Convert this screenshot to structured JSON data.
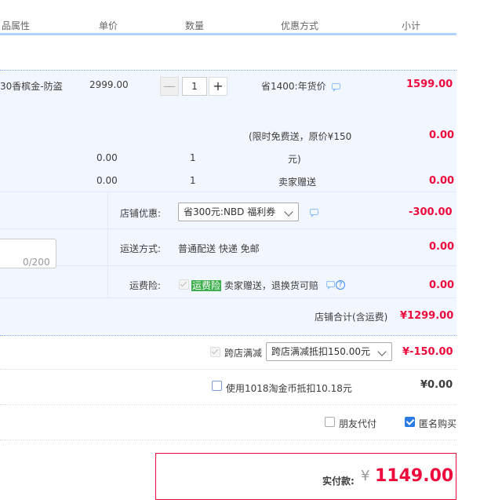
{
  "header": {
    "attr": "品属性",
    "price": "单价",
    "qty": "数量",
    "discount": "优惠方式",
    "subtotal": "小计"
  },
  "item": {
    "attr_text": "30香槟金-防盗",
    "price": "2999.00",
    "qty": "1",
    "discount": "省1400:年货价",
    "subtotal": "1599.00",
    "stepper_minus": "—",
    "stepper_plus": "+"
  },
  "gift": {
    "promo_line1": "(限时免费送，原价¥150",
    "promo_line2": "元)",
    "promo_amount": "0.00",
    "gift1_price": "0.00",
    "gift1_qty": "1",
    "gift2_price": "0.00",
    "gift2_qty": "1",
    "gift2_desc": "卖家赠送",
    "gift2_amount": "0.00"
  },
  "shop": {
    "coupon_label": "店铺优惠:",
    "coupon_select": "省300元:NBD 福利券",
    "coupon_amount": "-300.00",
    "shipping_label": "运送方式:",
    "shipping_value": "普通配送 快递 免邮",
    "shipping_amount": "0.00",
    "insurance_label": "运费险:",
    "insurance_tag": "运费险",
    "insurance_text": "卖家赠送，退换货可赔",
    "insurance_amount": "0.00",
    "char_count": "0/200",
    "total_label": "店铺合计(含运费)",
    "total_value": "¥1299.00"
  },
  "cross": {
    "label": "跨店满减",
    "select": "跨店满减抵扣150.00元",
    "amount": "¥-150.00"
  },
  "coins": {
    "label": "使用1018淘金币抵扣10.18元",
    "amount": "¥0.00"
  },
  "options": {
    "friend_pay": "朋友代付",
    "anonymous": "匿名购买"
  },
  "payment": {
    "label": "实付款:",
    "currency": "¥",
    "amount": "1149.00"
  },
  "colors": {
    "accent_red": "#ee0a3b",
    "blue_bg": "#f2f7ff",
    "header_line": "#b2d1ff",
    "checkbox_blue": "#2a7be4"
  }
}
